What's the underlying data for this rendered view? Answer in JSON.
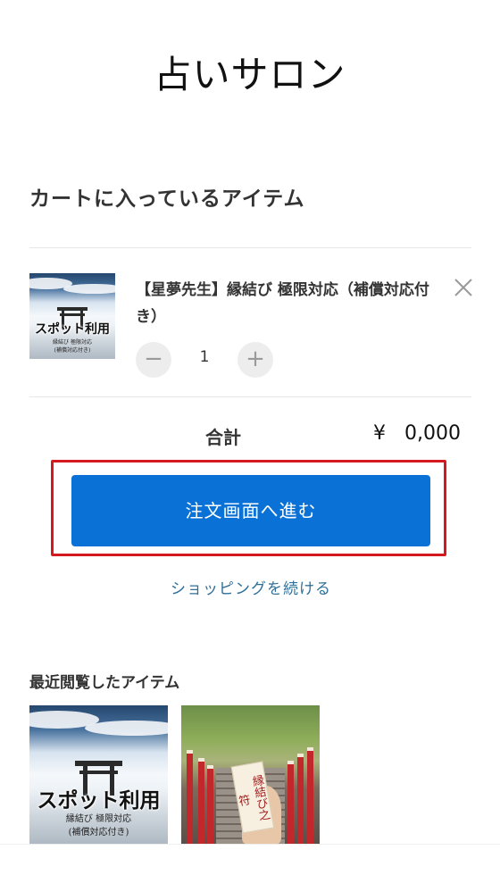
{
  "header": {
    "store_title": "占いサロン"
  },
  "cart": {
    "heading": "カートに入っているアイテム",
    "items": [
      {
        "name": "【星夢先生】縁結び 極限対応（補償対応付き）",
        "quantity": "1",
        "thumbnail": {
          "title_text": "スポット利用",
          "subtitle_line1": "縁結び 極限対応",
          "subtitle_line2": "(補償対応付き)"
        }
      }
    ],
    "remove_icon": "close-icon",
    "minus_icon": "minus-icon",
    "plus_icon": "plus-icon",
    "minus_symbol": "−",
    "plus_symbol": "+"
  },
  "summary": {
    "total_label": "合計",
    "total_amount": "¥   0,000"
  },
  "actions": {
    "checkout_label": "注文画面へ進む",
    "continue_label": "ショッピングを続ける"
  },
  "recent": {
    "heading": "最近閲覧したアイテム",
    "items": [
      {
        "title_text": "スポット利用",
        "subtitle_line1": "縁結び 極限対応",
        "subtitle_line2": "(補償対応付き)"
      },
      {
        "omamori_text": "縁結び之符"
      }
    ]
  },
  "colors": {
    "primary_button": "#0a72d6",
    "highlight_border": "#d4191f",
    "link": "#2f6f98"
  }
}
